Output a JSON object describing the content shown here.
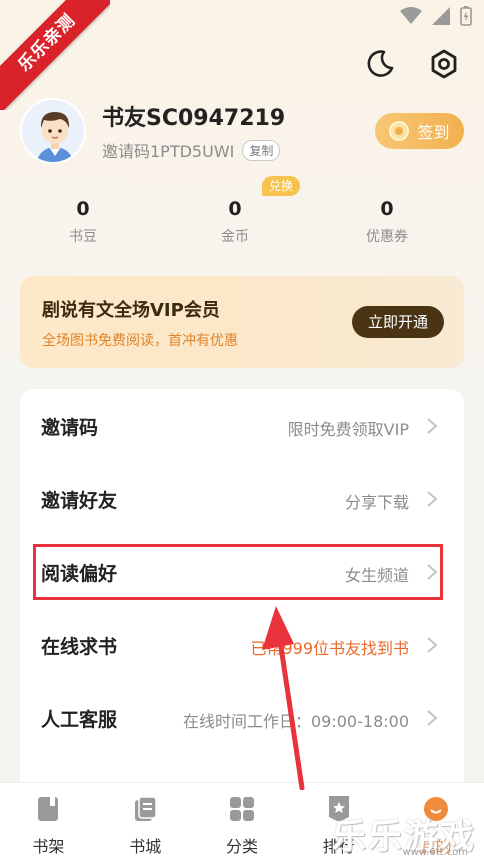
{
  "watermark": {
    "ribbon": "乐乐亲测",
    "bottom": "乐乐游戏",
    "url": "www.6tt.com"
  },
  "header": {
    "theme_icon": "moon-icon",
    "settings_icon": "settings-icon"
  },
  "profile": {
    "username": "书友SC0947219",
    "invite_code": "邀请码1PTD5UWI",
    "copy_label": "复制",
    "signin_label": "签到"
  },
  "stats": {
    "exchange_badge": "兑换",
    "items": [
      {
        "value": "0",
        "label": "书豆"
      },
      {
        "value": "0",
        "label": "金币"
      },
      {
        "value": "0",
        "label": "优惠券"
      }
    ]
  },
  "vip": {
    "title": "剧说有文全场VIP会员",
    "subtitle": "全场图书免费阅读，首冲有优惠",
    "button": "立即开通"
  },
  "menu": [
    {
      "label": "邀请码",
      "value": "限时免费领取VIP",
      "highlight": false
    },
    {
      "label": "邀请好友",
      "value": "分享下载",
      "highlight": false
    },
    {
      "label": "阅读偏好",
      "value": "女生频道",
      "highlight": true
    },
    {
      "label": "在线求书",
      "value": "已帮999位书友找到书",
      "highlight": false
    },
    {
      "label": "人工客服",
      "value": "在线时间工作日：09:00-18:00",
      "highlight": false
    }
  ],
  "tabs": [
    {
      "label": "书架",
      "icon": "bookshelf-icon"
    },
    {
      "label": "书城",
      "icon": "bookstore-icon"
    },
    {
      "label": "分类",
      "icon": "category-icon"
    },
    {
      "label": "排行",
      "icon": "ranking-icon"
    },
    {
      "label": "我的",
      "icon": "profile-icon"
    }
  ],
  "colors": {
    "accent": "#f3b04f",
    "highlight_border": "#e8323c",
    "orange_text": "#ea6a2a",
    "vip_button": "#4a3414"
  }
}
